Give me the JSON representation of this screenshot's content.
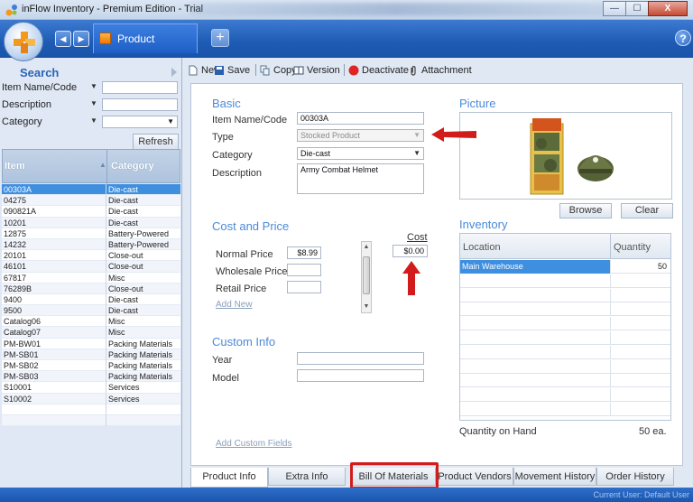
{
  "window": {
    "title": "inFlow Inventory - Premium Edition - Trial",
    "min_glyph": "—",
    "max_glyph": "☐",
    "close_glyph": "X"
  },
  "header": {
    "active_tab": "Product",
    "new_tab_glyph": "+",
    "help_glyph": "?"
  },
  "sidebar": {
    "title": "Search",
    "filters": [
      {
        "label": "Item Name/Code",
        "value": ""
      },
      {
        "label": "Description",
        "value": ""
      },
      {
        "label": "Category",
        "value": ""
      }
    ],
    "refresh_label": "Refresh",
    "columns": {
      "item": "Item",
      "category": "Category"
    },
    "rows": [
      {
        "item": "00303A",
        "category": "Die-cast",
        "selected": true
      },
      {
        "item": "04275",
        "category": "Die-cast"
      },
      {
        "item": "090821A",
        "category": "Die-cast"
      },
      {
        "item": "10201",
        "category": "Die-cast"
      },
      {
        "item": "12875",
        "category": "Battery-Powered"
      },
      {
        "item": "14232",
        "category": "Battery-Powered"
      },
      {
        "item": "20101",
        "category": "Close-out"
      },
      {
        "item": "46101",
        "category": "Close-out"
      },
      {
        "item": "67817",
        "category": "Misc"
      },
      {
        "item": "76289B",
        "category": "Close-out"
      },
      {
        "item": "9400",
        "category": "Die-cast"
      },
      {
        "item": "9500",
        "category": "Die-cast"
      },
      {
        "item": "Catalog06",
        "category": "Misc"
      },
      {
        "item": "Catalog07",
        "category": "Misc"
      },
      {
        "item": "PM-BW01",
        "category": "Packing Materials"
      },
      {
        "item": "PM-SB01",
        "category": "Packing Materials"
      },
      {
        "item": "PM-SB02",
        "category": "Packing Materials"
      },
      {
        "item": "PM-SB03",
        "category": "Packing Materials"
      },
      {
        "item": "S10001",
        "category": "Services"
      },
      {
        "item": "S10002",
        "category": "Services"
      }
    ]
  },
  "toolbar": {
    "new": "New",
    "save": "Save",
    "copy": "Copy",
    "version": "Version",
    "deactivate": "Deactivate",
    "attachment": "Attachment"
  },
  "basic": {
    "title": "Basic",
    "item_label": "Item Name/Code",
    "item_value": "00303A",
    "type_label": "Type",
    "type_value": "Stocked Product",
    "category_label": "Category",
    "category_value": "Die-cast",
    "description_label": "Description",
    "description_value": "Army Combat Helmet"
  },
  "picture": {
    "title": "Picture",
    "browse": "Browse",
    "clear": "Clear"
  },
  "cost_price": {
    "title": "Cost and Price",
    "cost_header": "Cost",
    "cost_value": "$0.00",
    "normal_label": "Normal Price",
    "normal_value": "$8.99",
    "wholesale_label": "Wholesale Price",
    "wholesale_value": "",
    "retail_label": "Retail Price",
    "retail_value": "",
    "add_new": "Add New"
  },
  "custom_info": {
    "title": "Custom Info",
    "year_label": "Year",
    "year_value": "",
    "model_label": "Model",
    "model_value": "",
    "add_custom": "Add Custom Fields"
  },
  "inventory": {
    "title": "Inventory",
    "col_location": "Location",
    "col_quantity": "Quantity",
    "rows": [
      {
        "location": "Main Warehouse",
        "quantity": "50"
      }
    ],
    "on_hand_label": "Quantity on Hand",
    "on_hand_value": "50 ea."
  },
  "tabs": [
    "Product Info",
    "Extra Info",
    "Bill Of Materials",
    "Product Vendors",
    "Movement History",
    "Order History"
  ],
  "status": {
    "user": "Current User:  Default User"
  },
  "colors": {
    "accent": "#3f8fe0",
    "annotation": "#d21c1c",
    "brand": "#1e5bb4"
  }
}
